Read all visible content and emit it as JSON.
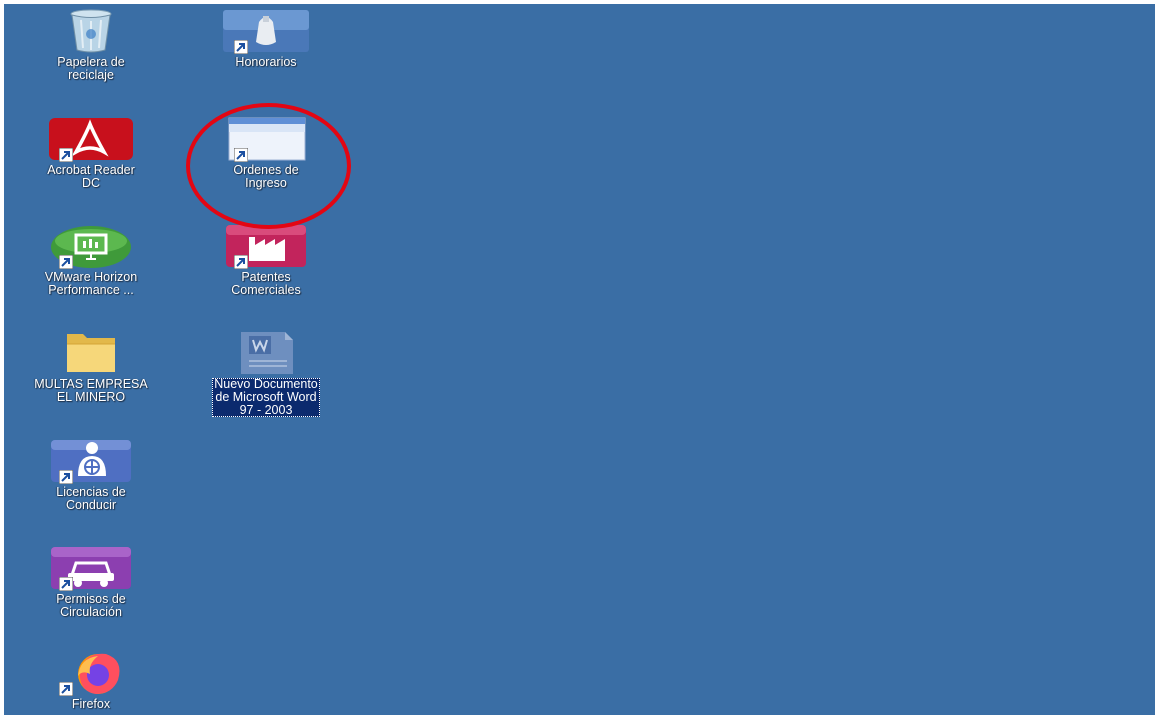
{
  "desktop": {
    "background": "#3a6ea5",
    "icons": [
      {
        "label": "Papelera de\nreciclaje",
        "icon": "recycle-bin-icon"
      },
      {
        "label": "Honorarios",
        "icon": "honorarios-app-icon",
        "shortcut": true
      },
      {
        "label": "Acrobat Reader\nDC",
        "icon": "acrobat-reader-icon",
        "shortcut": true
      },
      {
        "label": "Ordenes de\nIngreso",
        "icon": "window-app-icon",
        "shortcut": true
      },
      {
        "label": "VMware Horizon\nPerformance ...",
        "icon": "vmware-horizon-icon",
        "shortcut": true
      },
      {
        "label": "Patentes\nComerciales",
        "icon": "factory-icon",
        "shortcut": true
      },
      {
        "label": "MULTAS EMPRESA\nEL MINERO",
        "icon": "folder-icon"
      },
      {
        "label": "Nuevo Documento\nde Microsoft Word\n97 - 2003",
        "icon": "word-document-icon",
        "selected": true
      },
      {
        "label": "Licencias de\nConducir",
        "icon": "license-app-icon",
        "shortcut": true
      },
      {
        "label": "Permisos de\nCirculación",
        "icon": "car-app-icon",
        "shortcut": true
      },
      {
        "label": "Firefox",
        "icon": "firefox-icon",
        "shortcut": true
      }
    ]
  },
  "highlight": {
    "color": "#e30613",
    "target": "Ordenes de Ingreso"
  }
}
